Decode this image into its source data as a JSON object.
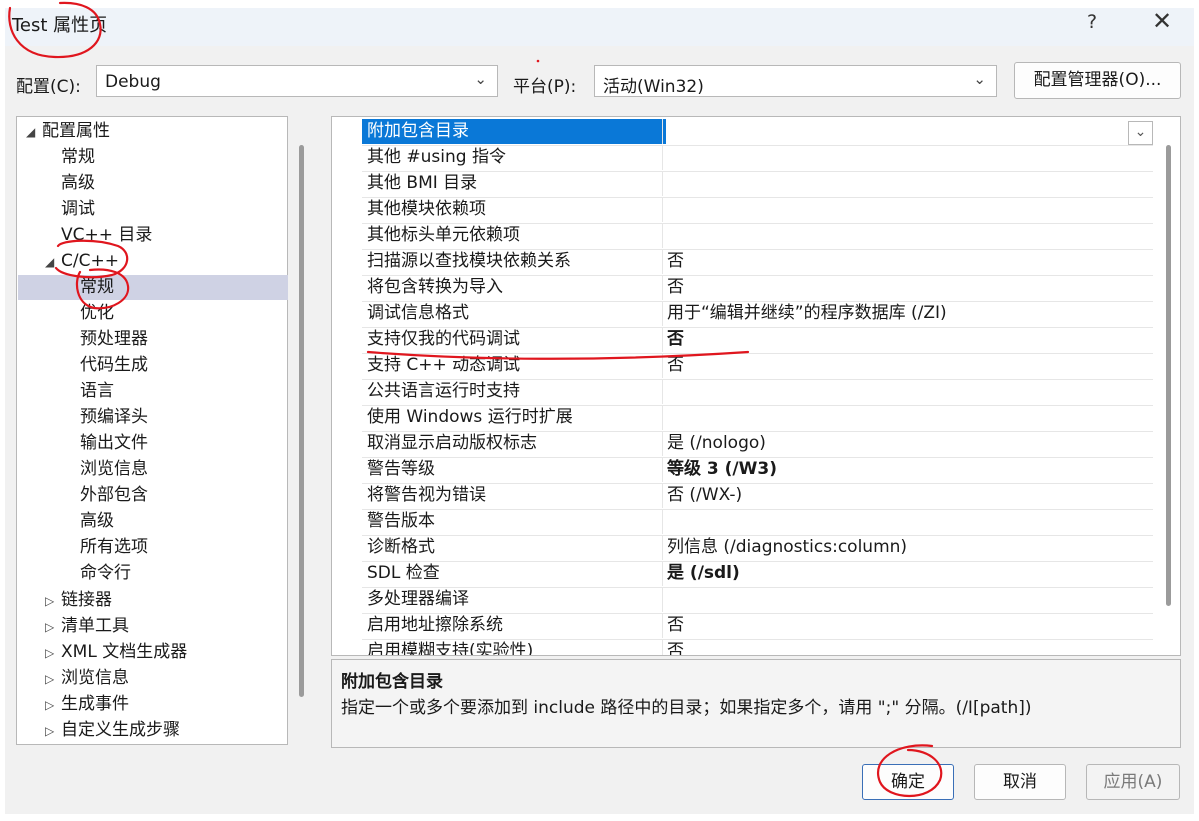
{
  "window": {
    "title": "Test 属性页",
    "help_label": "?",
    "close_label": "✕"
  },
  "config": {
    "label": "配置(C):",
    "value": "Debug",
    "platform_label": "平台(P):",
    "platform_value": "活动(Win32)",
    "manager_label": "配置管理器(O)..."
  },
  "tree": {
    "root": "配置属性",
    "general": "常规",
    "advanced": "高级",
    "debugging": "调试",
    "vcdirs": "VC++ 目录",
    "cpp": "C/C++",
    "cpp_children": [
      "常规",
      "优化",
      "预处理器",
      "代码生成",
      "语言",
      "预编译头",
      "输出文件",
      "浏览信息",
      "外部包含",
      "高级",
      "所有选项",
      "命令行"
    ],
    "collapsed": [
      "链接器",
      "清单工具",
      "XML 文档生成器",
      "浏览信息",
      "生成事件",
      "自定义生成步骤"
    ]
  },
  "properties": [
    {
      "name": "附加包含目录",
      "value": ""
    },
    {
      "name": "其他 #using 指令",
      "value": ""
    },
    {
      "name": "其他 BMI 目录",
      "value": ""
    },
    {
      "name": "其他模块依赖项",
      "value": ""
    },
    {
      "name": "其他标头单元依赖项",
      "value": ""
    },
    {
      "name": "扫描源以查找模块依赖关系",
      "value": "否"
    },
    {
      "name": "将包含转换为导入",
      "value": "否"
    },
    {
      "name": "调试信息格式",
      "value": "用于“编辑并继续”的程序数据库 (/ZI)"
    },
    {
      "name": "支持仅我的代码调试",
      "value": "否"
    },
    {
      "name": "支持 C++ 动态调试",
      "value": "否"
    },
    {
      "name": "公共语言运行时支持",
      "value": ""
    },
    {
      "name": "使用 Windows 运行时扩展",
      "value": ""
    },
    {
      "name": "取消显示启动版权标志",
      "value": "是 (/nologo)"
    },
    {
      "name": "警告等级",
      "value": "等级 3 (/W3)"
    },
    {
      "name": "将警告视为错误",
      "value": "否 (/WX-)"
    },
    {
      "name": "警告版本",
      "value": ""
    },
    {
      "name": "诊断格式",
      "value": "列信息 (/diagnostics:column)"
    },
    {
      "name": "SDL 检查",
      "value": "是 (/sdl)"
    },
    {
      "name": "多处理器编译",
      "value": ""
    },
    {
      "name": "启用地址擦除系统",
      "value": "否"
    },
    {
      "name": "启用模糊支持(实验性)",
      "value": "否"
    }
  ],
  "description": {
    "title": "附加包含目录",
    "text": "指定一个或多个要添加到 include 路径中的目录；如果指定多个，请用 \";\" 分隔。(/I[path])"
  },
  "buttons": {
    "ok": "确定",
    "cancel": "取消",
    "apply": "应用(A)"
  },
  "colors": {
    "selection": "#0a78d7",
    "tree_selection": "#cfd2e4",
    "annotation": "#e0161e"
  }
}
